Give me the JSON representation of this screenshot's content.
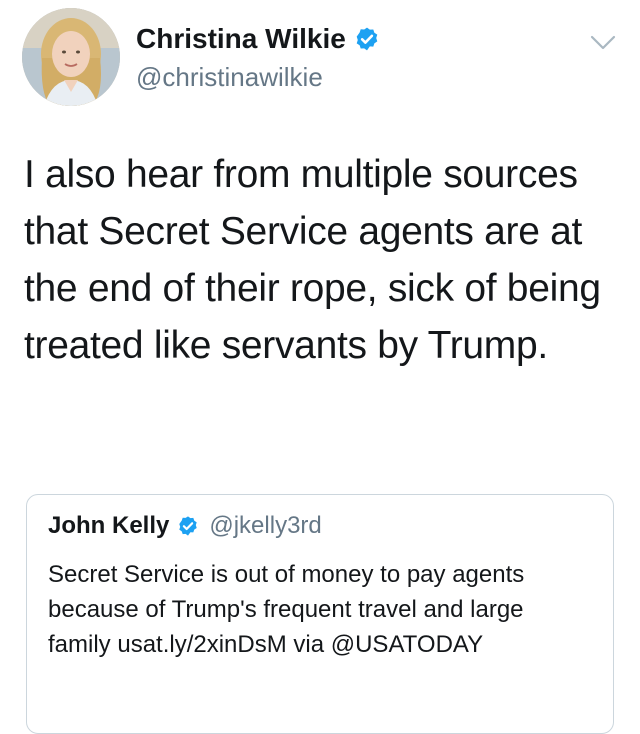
{
  "tweet": {
    "author": {
      "display_name": "Christina Wilkie",
      "handle": "@christinawilkie",
      "verified": true,
      "avatar_icon": "profile-photo"
    },
    "text": "I also hear from multiple sources that Secret Service agents are at the end of their rope, sick of being treated like servants by Trump.",
    "menu_icon": "chevron-down-icon"
  },
  "quoted_tweet": {
    "author": {
      "display_name": "John Kelly",
      "handle": "@jkelly3rd",
      "verified": true
    },
    "text": "Secret Service is out of money to pay agents because of Trump's frequent travel and large family usat.ly/2xinDsM via @USATODAY"
  },
  "colors": {
    "verified_blue": "#1da1f2",
    "secondary_text": "#657786",
    "primary_text": "#14171a",
    "card_border": "#ccd6dd"
  }
}
